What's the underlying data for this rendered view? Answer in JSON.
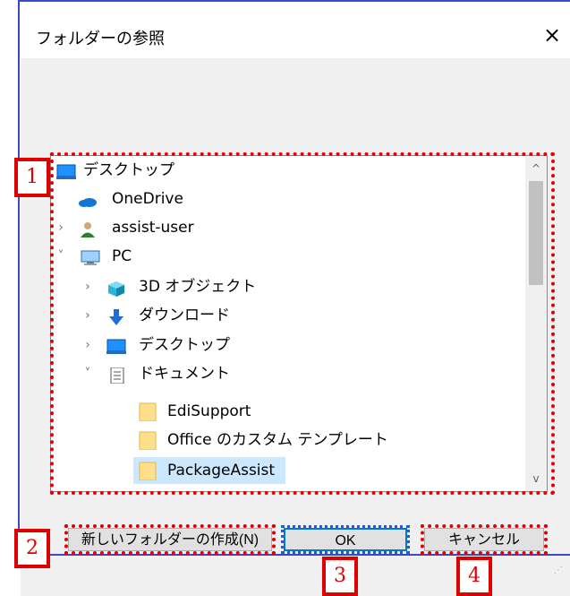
{
  "dialog": {
    "title": "フォルダーの参照",
    "close_glyph": "×"
  },
  "tree": [
    {
      "label": "デスクトップ",
      "icon": "desktop-icon",
      "expander": ""
    },
    {
      "label": "OneDrive",
      "icon": "cloud-icon",
      "expander": ""
    },
    {
      "label": "assist-user",
      "icon": "user-icon",
      "expander": "›"
    },
    {
      "label": "PC",
      "icon": "pc-icon",
      "expander": "˅"
    },
    {
      "label": "3D オブジェクト",
      "icon": "cube-icon",
      "expander": "›"
    },
    {
      "label": "ダウンロード",
      "icon": "download-icon",
      "expander": "›"
    },
    {
      "label": "デスクトップ",
      "icon": "desktop-icon",
      "expander": "›"
    },
    {
      "label": "ドキュメント",
      "icon": "document-icon",
      "expander": "˅"
    },
    {
      "label": "EdiSupport",
      "icon": "folder-icon",
      "expander": ""
    },
    {
      "label": "Office のカスタム テンプレート",
      "icon": "folder-icon",
      "expander": ""
    },
    {
      "label": "PackageAssist",
      "icon": "folder-icon",
      "expander": "",
      "selected": true
    }
  ],
  "scroll": {
    "up": "^",
    "down": "v"
  },
  "buttons": {
    "new_folder": "新しいフォルダーの作成(N)",
    "ok": "OK",
    "cancel": "キャンセル"
  },
  "callouts": {
    "one": "1",
    "two": "2",
    "three": "3",
    "four": "4"
  },
  "colors": {
    "callout": "#e00000",
    "selection": "#cce8ff",
    "focus": "#1a5fd6"
  }
}
